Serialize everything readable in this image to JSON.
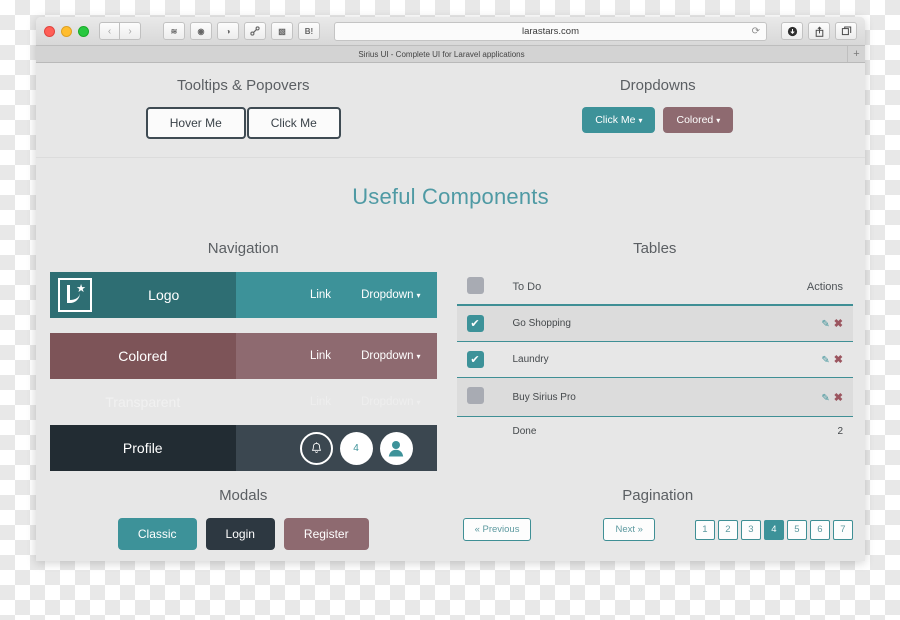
{
  "browser": {
    "url": "larastars.com",
    "reload_icon": "reload-icon",
    "back_icon": "‹",
    "forward_icon": "›",
    "bookmarks": [
      {
        "name": "layers-icon",
        "glyph": "≋"
      },
      {
        "name": "camera-icon",
        "glyph": "◉"
      },
      {
        "name": "info-icon",
        "glyph": "◑"
      },
      {
        "name": "link-icon",
        "glyph": "🔗"
      },
      {
        "name": "book-icon",
        "glyph": "▧"
      },
      {
        "name": "behance-icon",
        "glyph": "B!"
      }
    ],
    "right_buttons": [
      {
        "name": "download-icon",
        "glyph": "⬇"
      },
      {
        "name": "share-icon",
        "glyph": "⇧"
      },
      {
        "name": "tabs-icon",
        "glyph": "❐"
      }
    ],
    "tab_title": "Sirius UI - Complete UI for Laravel applications",
    "new_tab_label": "+"
  },
  "colors": {
    "teal": "#3d9299",
    "teal_dark": "#2e6e73",
    "maroon": "#8e6a70",
    "maroon_dark": "#7d5458",
    "dark": "#2d3841",
    "heading_teal": "#4f9aa4",
    "page_bg": "#e7e7e7"
  },
  "tooltips": {
    "title": "Tooltips & Popovers",
    "hover_label": "Hover Me",
    "click_label": "Click Me"
  },
  "dropdowns": {
    "title": "Dropdowns",
    "primary_label": "Click Me",
    "colored_label": "Colored",
    "caret": "▾"
  },
  "main_heading": "Useful Components",
  "navigation": {
    "title": "Navigation",
    "rows": [
      {
        "variant": "teal",
        "brand": "Logo",
        "link": "Link",
        "dropdown": "Dropdown",
        "has_logo": true
      },
      {
        "variant": "maroon",
        "brand": "Colored",
        "link": "Link",
        "dropdown": "Dropdown",
        "has_logo": false
      },
      {
        "variant": "transparent",
        "brand": "Transparent",
        "link": "Link",
        "dropdown": "Dropdown",
        "has_logo": false
      }
    ],
    "profile": {
      "brand": "Profile",
      "bell_icon": "bell-icon",
      "badge_count": "4",
      "avatar_icon": "user-avatar-icon"
    },
    "caret": "▾"
  },
  "tables": {
    "title": "Tables",
    "columns": [
      "",
      "To Do",
      "Actions"
    ],
    "rows": [
      {
        "checked": true,
        "task": "Go Shopping",
        "edit": "edit-icon",
        "delete": "delete-icon"
      },
      {
        "checked": true,
        "task": "Laundry",
        "edit": "edit-icon",
        "delete": "delete-icon"
      },
      {
        "checked": false,
        "task": "Buy Sirius Pro",
        "edit": "edit-icon",
        "delete": "delete-icon"
      }
    ],
    "footer": {
      "label": "Done",
      "value": "2"
    },
    "edit_glyph": "✎",
    "delete_glyph": "✖",
    "check_glyph": "✔"
  },
  "modals": {
    "title": "Modals",
    "buttons": [
      {
        "label": "Classic",
        "style": "teal"
      },
      {
        "label": "Login",
        "style": "dark"
      },
      {
        "label": "Register",
        "style": "maroon"
      }
    ]
  },
  "pagination": {
    "title": "Pagination",
    "previous_label": "« Previous",
    "next_label": "Next »",
    "pages": [
      "1",
      "2",
      "3",
      "4",
      "5",
      "6",
      "7"
    ],
    "active_page": "4"
  }
}
